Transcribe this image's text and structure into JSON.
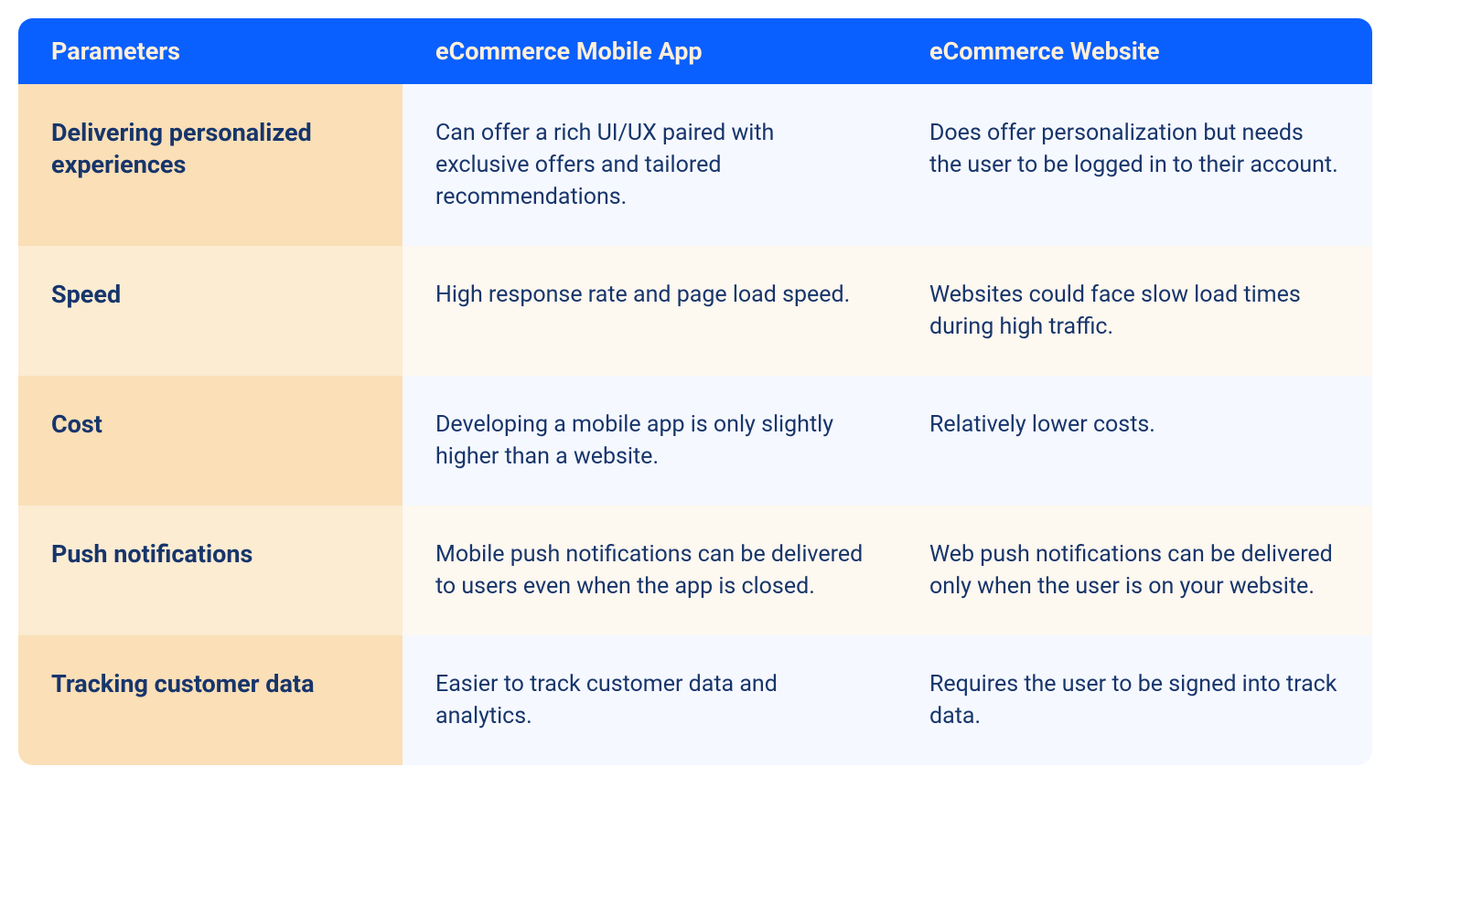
{
  "chart_data": {
    "type": "table",
    "headers": [
      "Parameters",
      "eCommerce Mobile App",
      "eCommerce Website"
    ],
    "rows": [
      {
        "parameter": "Delivering personalized experiences",
        "mobile_app": "Can offer a rich UI/UX paired with exclusive offers and tailored recommendations.",
        "website": "Does offer personalization but needs the user to be logged in to their account."
      },
      {
        "parameter": "Speed",
        "mobile_app": "High response rate and page load speed.",
        "website": "Websites could face slow load times during high traffic."
      },
      {
        "parameter": "Cost",
        "mobile_app": "Developing a mobile app is only slightly higher than a website.",
        "website": "Relatively lower costs."
      },
      {
        "parameter": "Push notifications",
        "mobile_app": "Mobile push notifications can be delivered to users even when the app is closed.",
        "website": "Web push notifications can be delivered only when the user is on your website."
      },
      {
        "parameter": "Tracking customer data",
        "mobile_app": "Easier to track customer data and analytics.",
        "website": "Requires the user to be signed into track data."
      }
    ]
  },
  "colors": {
    "header_bg": "#0A5FFF",
    "header_text": "#FFEFD9",
    "param_bg": "#FADFB7",
    "param_bg_alt": "#FBECD2",
    "data_bg": "#F5F8FF",
    "data_bg_alt": "#FDF8F0",
    "text_dark": "#17356B"
  }
}
